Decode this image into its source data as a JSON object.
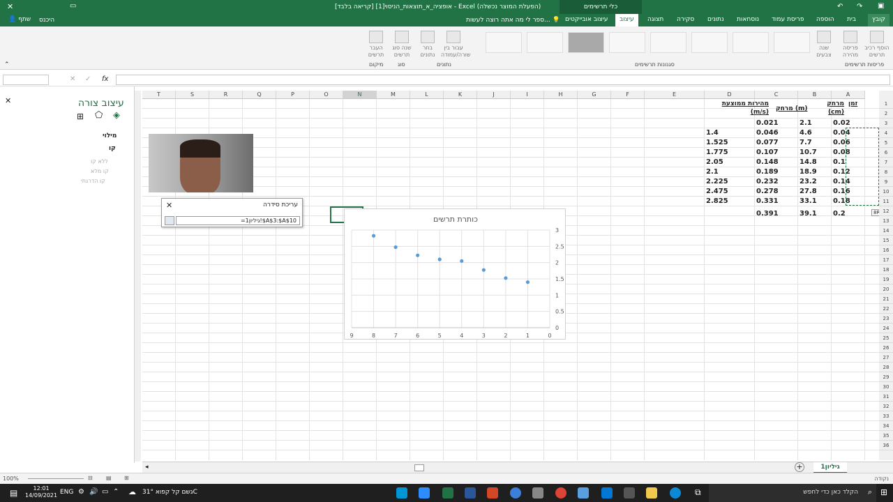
{
  "titlebar": {
    "title": "אופציה_א_תוצאות_הניסוי[1]  [קריאה בלבד]  - Excel  (הפעלת המוצר נכשלה)",
    "context": "כלי תרשימים",
    "signin": "היכנס",
    "share": "שתף",
    "close_glyph": "✕"
  },
  "ribbon": {
    "tabs": [
      "קובץ",
      "בית",
      "הוספה",
      "פריסת עמוד",
      "נוסחאות",
      "נתונים",
      "סקירה",
      "תצוגה",
      "עיצוב",
      "עיצוב אובייקטים"
    ],
    "tell_me": "ספר לי מה אתה רוצה לעשות...",
    "buttons": {
      "move_chart": "העבר תרשים",
      "change_type": "שנה סוג תרשים",
      "select_data": "בחר נתונים",
      "switch_rowcol": "עבור בין שורה/עמודה",
      "change_colors": "שנה צבעים",
      "quick_layout": "פריסה מהירה",
      "add_element": "הוסף רכיב תרשים"
    },
    "groups": {
      "location": "מיקום",
      "type": "סוג",
      "data": "נתונים",
      "styles": "סגנונות תרשימים",
      "layouts": "פריסות תרשימים"
    }
  },
  "formula_bar": {
    "fx": "fx"
  },
  "format_pane": {
    "title": "עיצוב צורה",
    "section_fill": "מילוי",
    "section_line": "קו",
    "options": [
      "ללא קו",
      "קו מלא",
      "קו הדרגתי"
    ]
  },
  "grid": {
    "columns": [
      "T",
      "S",
      "R",
      "Q",
      "P",
      "O",
      "N",
      "M",
      "L",
      "K",
      "J",
      "I",
      "H",
      "G",
      "F",
      "E",
      "D",
      "C",
      "B",
      "A"
    ],
    "rows": [
      "1",
      "2",
      "3",
      "4",
      "5",
      "6",
      "7",
      "8",
      "9",
      "10",
      "11",
      "12",
      "13",
      "14",
      "15",
      "16",
      "17",
      "18",
      "19",
      "20",
      "21",
      "22",
      "23",
      "24",
      "25",
      "26",
      "27",
      "28",
      "29",
      "30",
      "31",
      "32",
      "33",
      "34",
      "35",
      "36"
    ],
    "headers": {
      "A": "זמן",
      "B": "מרחק (cm)",
      "C": "מרחק (m)",
      "D": "מהירות ממוצעת (m/s)"
    },
    "col_A": [
      "0.02",
      "0.04",
      "0.06",
      "0.08",
      "0.1",
      "0.12",
      "0.14",
      "0.16",
      "0.18",
      "0.2"
    ],
    "col_B": [
      "2.1",
      "4.6",
      "7.7",
      "10.7",
      "14.8",
      "18.9",
      "23.2",
      "27.8",
      "33.1",
      "39.1"
    ],
    "col_C": [
      "0.021",
      "0.046",
      "0.077",
      "0.107",
      "0.148",
      "0.189",
      "0.232",
      "0.278",
      "0.331",
      "0.391"
    ],
    "col_D": [
      "",
      "1.4",
      "1.525",
      "1.775",
      "2.05",
      "2.1",
      "2.225",
      "2.475",
      "2.825",
      ""
    ],
    "selection_tip": "8R x 1C"
  },
  "series_dialog": {
    "title": "עריכת סידרה",
    "value": "=גיליון1!$A$3:$A$10"
  },
  "chart_data": {
    "type": "scatter",
    "title": "כותרת תרשים",
    "x": [
      1,
      2,
      3,
      4,
      5,
      6,
      7,
      8
    ],
    "y": [
      1.4,
      1.525,
      1.775,
      2.05,
      2.1,
      2.225,
      2.475,
      2.825
    ],
    "xlim": [
      0,
      9
    ],
    "ylim": [
      0,
      3
    ],
    "x_reversed": true,
    "x_ticks": [
      "0",
      "1",
      "2",
      "3",
      "4",
      "5",
      "6",
      "7",
      "8",
      "9"
    ],
    "y_ticks": [
      "0",
      "0.5",
      "1",
      "1.5",
      "2",
      "2.5",
      "3"
    ],
    "grid": true,
    "marker_color": "#5b9bd5"
  },
  "sheet": {
    "tab": "גיליון1",
    "add": "+"
  },
  "status": {
    "mode": "נקודה",
    "zoom": "100%"
  },
  "taskbar": {
    "search": "הקלד כאן כדי לחפש",
    "weather": "גשם קל קפוא  31°C",
    "lang": "ENG",
    "time": "12:01",
    "date": "14/09/2021"
  },
  "colors": {
    "excel_green": "#217346",
    "taskbar": "#1f1f1f"
  }
}
